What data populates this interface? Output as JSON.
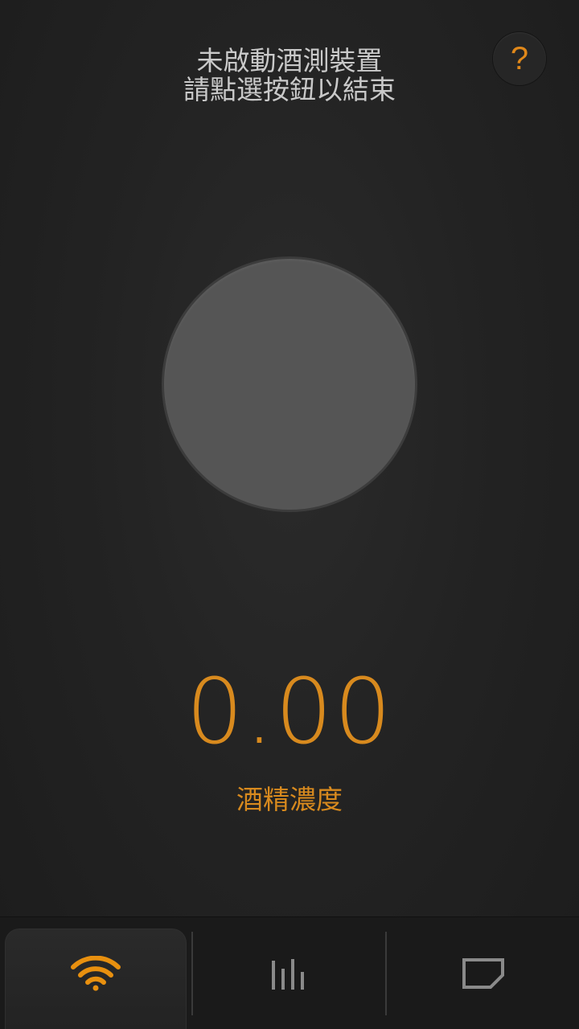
{
  "status": {
    "line1": "未啟動酒測裝置",
    "line2": "請點選按鈕以結束"
  },
  "help_button": {
    "label": "?"
  },
  "reading": {
    "value": "0.00",
    "label": "酒精濃度"
  },
  "tabs": [
    {
      "icon": "wifi-icon",
      "active": true
    },
    {
      "icon": "bar-chart-icon",
      "active": false
    },
    {
      "icon": "note-icon",
      "active": false
    }
  ],
  "colors": {
    "accent": "#d88a1e",
    "background": "#232323",
    "start_button": "#555555",
    "inactive_icon": "#8a8a8a"
  }
}
